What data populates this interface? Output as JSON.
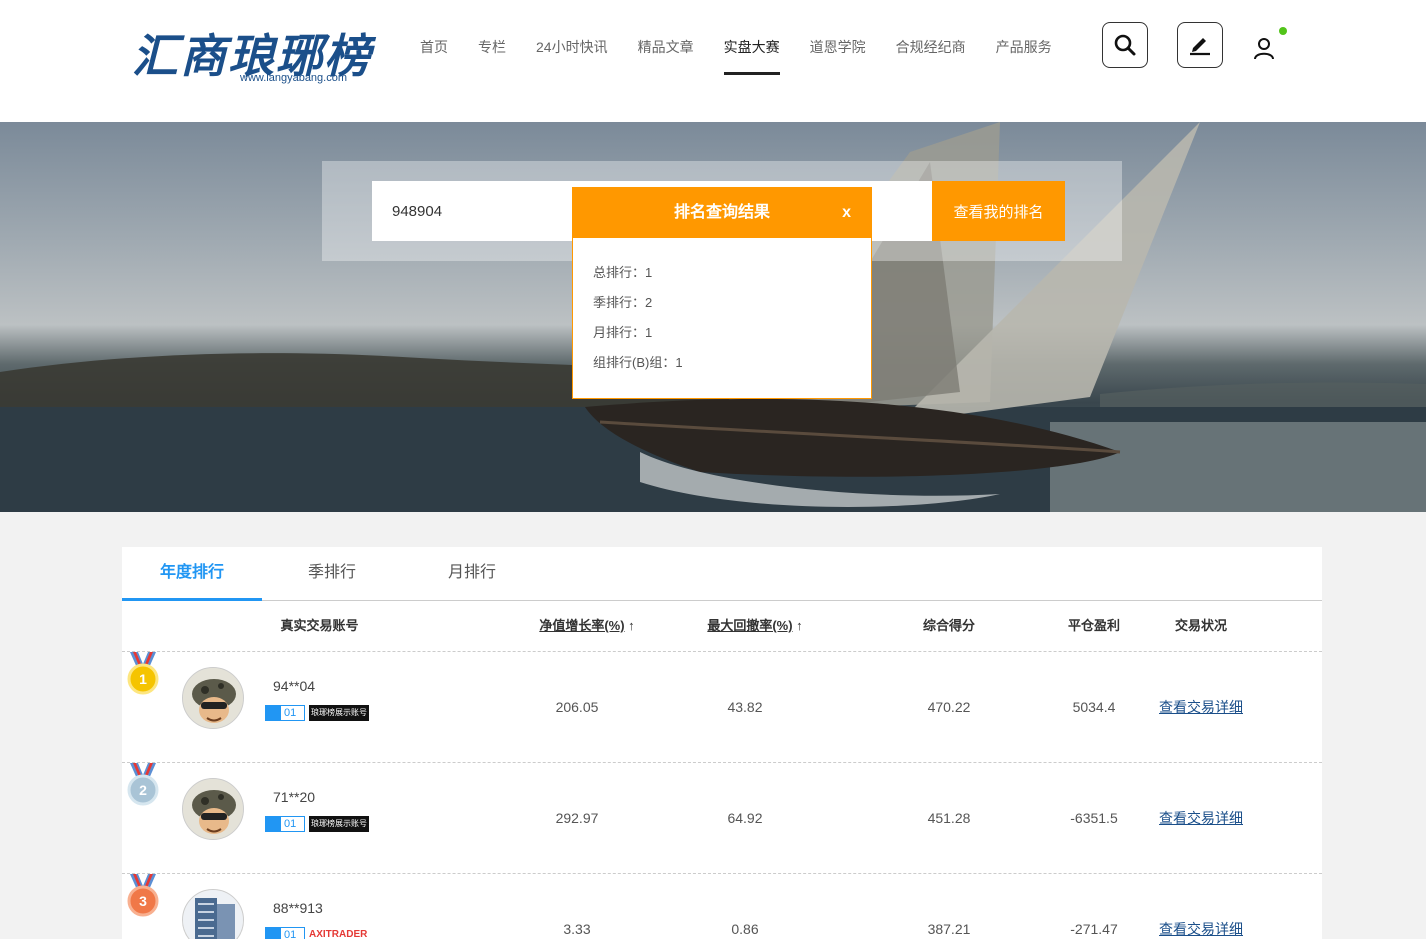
{
  "header": {
    "logo_text": "汇商琅琊榜",
    "logo_url": "www.langyabang.com",
    "nav": [
      {
        "label": "首页"
      },
      {
        "label": "专栏"
      },
      {
        "label": "24小时快讯"
      },
      {
        "label": "精品文章"
      },
      {
        "label": "实盘大赛"
      },
      {
        "label": "道恩学院"
      },
      {
        "label": "合规经纪商"
      },
      {
        "label": "产品服务"
      }
    ],
    "active_nav": "实盘大赛"
  },
  "search": {
    "value": "948904",
    "button_label": "查看我的排名"
  },
  "popup": {
    "title": "排名查询结果",
    "close_label": "x",
    "rows": [
      {
        "text": "总排行：1"
      },
      {
        "text": "季排行：2"
      },
      {
        "text": "月排行：1"
      },
      {
        "text": "组排行(B)组：1"
      }
    ]
  },
  "tabs": [
    {
      "label": "年度排行"
    },
    {
      "label": "季排行"
    },
    {
      "label": "月排行"
    }
  ],
  "table": {
    "headers": {
      "account": "真实交易账号",
      "growth": "净值增长率(%)",
      "drawdown": "最大回撤率(%)",
      "score": "综合得分",
      "profit": "平仓盈利",
      "status": "交易状况"
    },
    "sort_arrow": "↑",
    "rows": [
      {
        "rank": "1",
        "account": "94**04",
        "badge": "01",
        "tag": "琅琊榜展示账号",
        "growth": "206.05",
        "drawdown": "43.82",
        "score": "470.22",
        "profit": "5034.4",
        "link": "查看交易详细"
      },
      {
        "rank": "2",
        "account": "71**20",
        "badge": "01",
        "tag": "琅琊榜展示账号",
        "growth": "292.97",
        "drawdown": "64.92",
        "score": "451.28",
        "profit": "-6351.5",
        "link": "查看交易详细"
      },
      {
        "rank": "3",
        "account": "88**913",
        "badge": "01",
        "tag": "AXITRADER",
        "growth": "3.33",
        "drawdown": "0.86",
        "score": "387.21",
        "profit": "-271.47",
        "link": "查看交易详细"
      }
    ]
  },
  "colors": {
    "accent": "#ff9800",
    "tab_active": "#2196f3",
    "link": "#1b4f8a",
    "online": "#52c41a"
  }
}
